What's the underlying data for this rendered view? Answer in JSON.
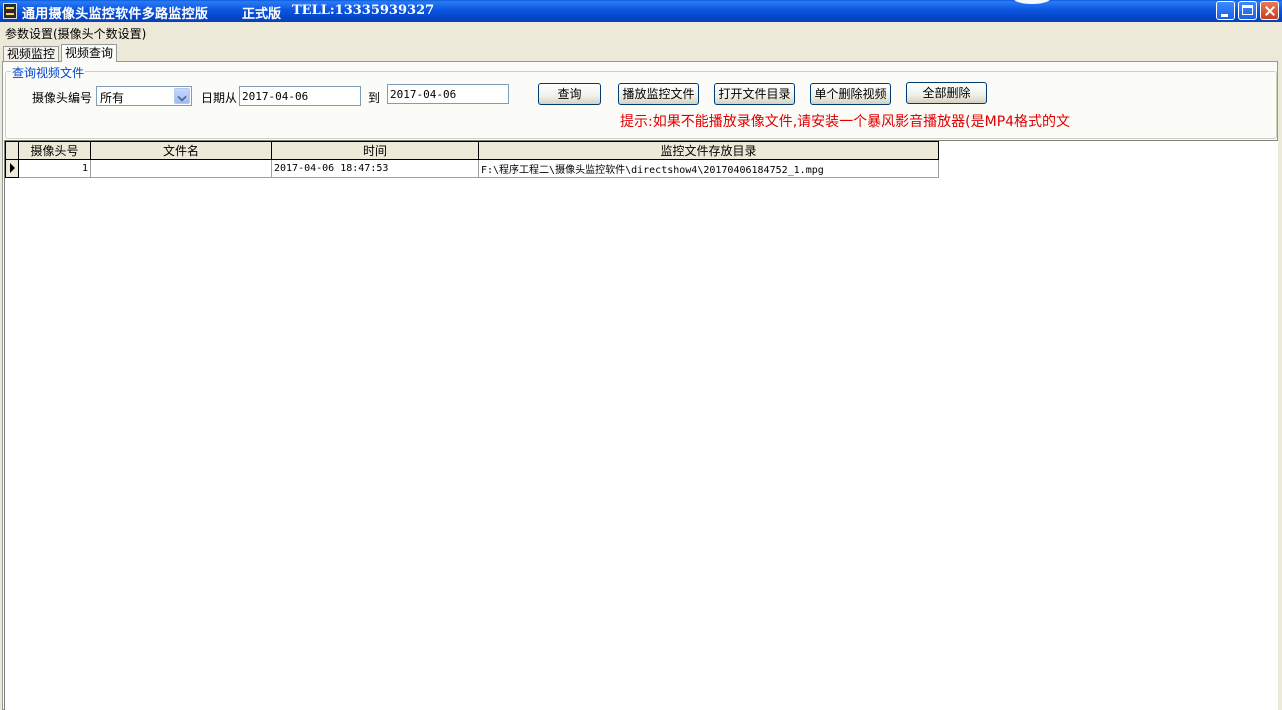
{
  "window": {
    "title": "通用摄像头监控软件多路监控版",
    "edition": "正式版",
    "tel": "TELL:13335939327",
    "icon": "film-icon"
  },
  "menu": {
    "item": "参数设置(摄像头个数设置)"
  },
  "tabs": [
    {
      "label": "视频监控"
    },
    {
      "label": "视频查询"
    }
  ],
  "query": {
    "group_title": "查询视频文件",
    "camera_label": "摄像头编号",
    "camera_value": "所有",
    "date_from_label": "日期从",
    "date_from": "2017-04-06",
    "date_to_label": "到",
    "date_to": "2017-04-06",
    "buttons": {
      "search": "查询",
      "play": "播放监控文件",
      "open_dir": "打开文件目录",
      "delete_one": "单个删除视频",
      "delete_all": "全部删除"
    },
    "hint": "提示:如果不能播放录像文件,请安装一个暴风影音播放器(是MP4格式的文"
  },
  "grid": {
    "columns": [
      "摄像头号",
      "文件名",
      "时间",
      "监控文件存放目录"
    ],
    "rows": [
      {
        "camera": "1",
        "filename": "",
        "time": "2017-04-06 18:47:53",
        "path": "F:\\程序工程二\\摄像头监控软件\\directshow4\\20170406184752_1.mpg"
      }
    ]
  },
  "colors": {
    "hint": "#e00000",
    "group_title": "#0046d5",
    "titlebar": "#0446c8"
  }
}
